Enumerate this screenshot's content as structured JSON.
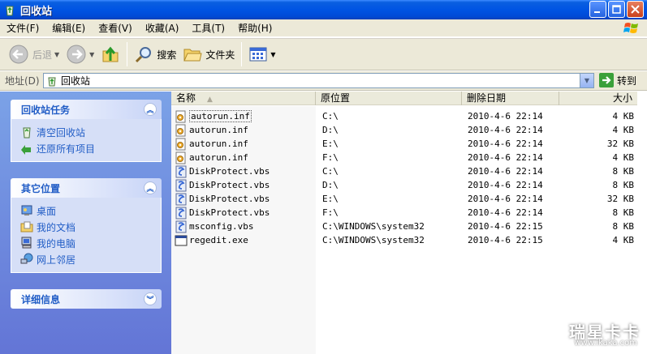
{
  "window": {
    "title": "回收站"
  },
  "menu": [
    "文件(F)",
    "编辑(E)",
    "查看(V)",
    "收藏(A)",
    "工具(T)",
    "帮助(H)"
  ],
  "toolbar": {
    "back": "后退",
    "search": "搜索",
    "folders": "文件夹"
  },
  "address": {
    "label": "地址(D)",
    "value": "回收站",
    "go": "转到"
  },
  "panels": [
    {
      "title": "回收站任务",
      "items": [
        "清空回收站",
        "还原所有项目"
      ]
    },
    {
      "title": "其它位置",
      "items": [
        "桌面",
        "我的文档",
        "我的电脑",
        "网上邻居"
      ]
    },
    {
      "title": "详细信息",
      "items": []
    }
  ],
  "columns": {
    "name": "名称",
    "origin": "原位置",
    "deleted": "删除日期",
    "size": "大小"
  },
  "files": [
    {
      "name": "autorun.inf",
      "type": "inf",
      "origin": "C:\\",
      "date": "2010-4-6 22:14",
      "size": "4 KB"
    },
    {
      "name": "autorun.inf",
      "type": "inf",
      "origin": "D:\\",
      "date": "2010-4-6 22:14",
      "size": "4 KB"
    },
    {
      "name": "autorun.inf",
      "type": "inf",
      "origin": "E:\\",
      "date": "2010-4-6 22:14",
      "size": "32 KB"
    },
    {
      "name": "autorun.inf",
      "type": "inf",
      "origin": "F:\\",
      "date": "2010-4-6 22:14",
      "size": "4 KB"
    },
    {
      "name": "DiskProtect.vbs",
      "type": "vbs",
      "origin": "C:\\",
      "date": "2010-4-6 22:14",
      "size": "8 KB"
    },
    {
      "name": "DiskProtect.vbs",
      "type": "vbs",
      "origin": "D:\\",
      "date": "2010-4-6 22:14",
      "size": "8 KB"
    },
    {
      "name": "DiskProtect.vbs",
      "type": "vbs",
      "origin": "E:\\",
      "date": "2010-4-6 22:14",
      "size": "32 KB"
    },
    {
      "name": "DiskProtect.vbs",
      "type": "vbs",
      "origin": "F:\\",
      "date": "2010-4-6 22:14",
      "size": "8 KB"
    },
    {
      "name": "msconfig.vbs",
      "type": "vbs",
      "origin": "C:\\WINDOWS\\system32",
      "date": "2010-4-6 22:15",
      "size": "8 KB"
    },
    {
      "name": "regedit.exe",
      "type": "exe",
      "origin": "C:\\WINDOWS\\system32",
      "date": "2010-4-6 22:15",
      "size": "4 KB"
    }
  ],
  "watermark": {
    "text": "瑞星卡卡",
    "url": "www.ikaka.com"
  }
}
